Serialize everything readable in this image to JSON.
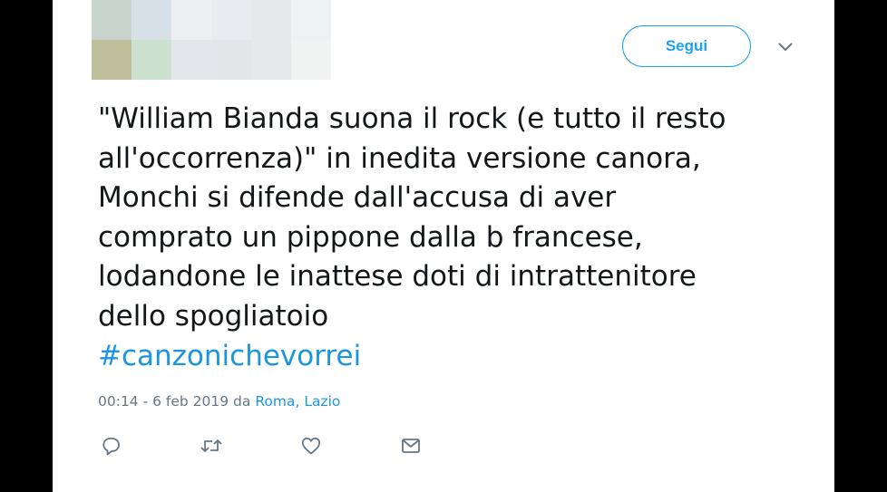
{
  "tweet": {
    "follow_label": "Segui",
    "text_lines": [
      "\"William Bianda suona il rock (e tutto il resto",
      "all'occorrenza)\" in inedita versione canora,",
      "Monchi si difende dall'accusa di aver",
      "comprato un pippone dalla b francese,",
      "lodandone le inattese doti di intrattenitore",
      "dello spogliatoio"
    ],
    "hashtag": "#canzonichevorrei",
    "timestamp": "00:14 - 6 feb 2019",
    "from_label": "da",
    "location": "Roma, Lazio"
  },
  "colors": {
    "accent": "#1da1f2",
    "link": "#1b95e0",
    "text": "#14171a",
    "muted": "#657786",
    "background": "#000000",
    "card": "#ffffff"
  },
  "icons": {
    "menu": "chevron-down-icon",
    "reply": "reply-icon",
    "retweet": "retweet-icon",
    "like": "heart-icon",
    "message": "envelope-icon"
  }
}
